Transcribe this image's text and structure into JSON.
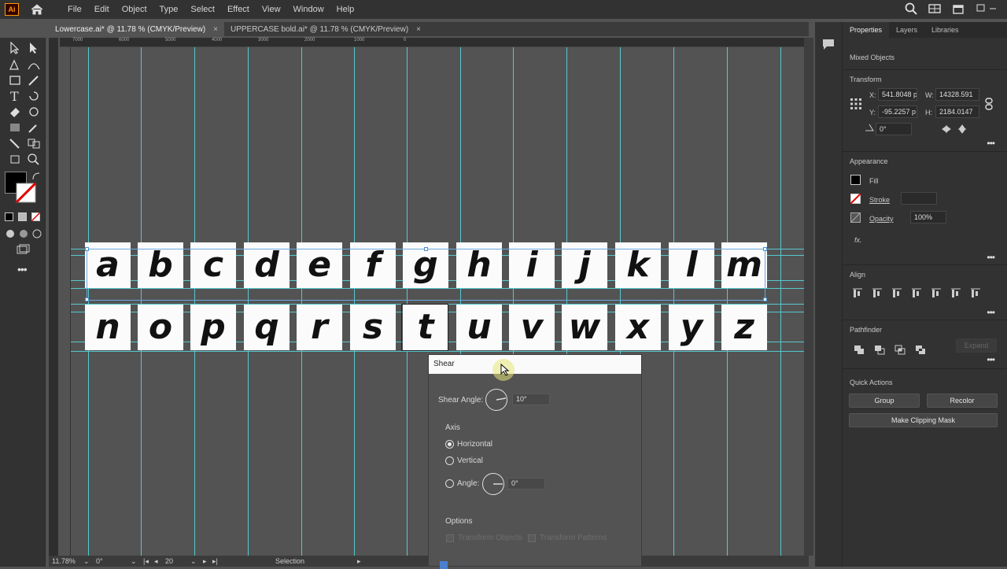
{
  "app": {
    "logo": "Ai"
  },
  "menu": [
    "File",
    "Edit",
    "Object",
    "Type",
    "Select",
    "Effect",
    "View",
    "Window",
    "Help"
  ],
  "tabs": [
    {
      "label": "Lowercase.ai* @ 11.78 % (CMYK/Preview)",
      "close": "×"
    },
    {
      "label": "UPPERCASE bold.ai* @ 11.78 % (CMYK/Preview)",
      "close": "×"
    }
  ],
  "ruler": [
    "7000",
    "6000",
    "5000",
    "4000",
    "3000",
    "2000",
    "1000",
    "0"
  ],
  "letters_row1": [
    "a",
    "b",
    "c",
    "d",
    "e",
    "f",
    "g",
    "h",
    "i",
    "j",
    "k",
    "l",
    "m"
  ],
  "letters_row2": [
    "n",
    "o",
    "p",
    "q",
    "r",
    "s",
    "t",
    "u",
    "v",
    "w",
    "x",
    "y",
    "z"
  ],
  "status": {
    "zoom": "11.78%",
    "rotate": "0°",
    "artboard": "20",
    "tool": "Selection"
  },
  "panel": {
    "tabs": [
      "Properties",
      "Layers",
      "Libraries"
    ],
    "selection": "Mixed Objects",
    "transform": {
      "title": "Transform",
      "x_label": "X:",
      "x": "541.8048 p",
      "y_label": "Y:",
      "y": "-95.2257 p",
      "w_label": "W:",
      "w": "14328.591",
      "h_label": "H:",
      "h": "2184.0147",
      "angle": "0°"
    },
    "appearance": {
      "title": "Appearance",
      "fill": "Fill",
      "stroke": "Stroke",
      "opacity": "Opacity",
      "opacity_value": "100%",
      "fx": "fx."
    },
    "align": {
      "title": "Align"
    },
    "pathfinder": {
      "title": "Pathfinder",
      "expand": "Expand"
    },
    "quick_actions": {
      "title": "Quick Actions",
      "group": "Group",
      "recolor": "Recolor",
      "clipping": "Make Clipping Mask"
    }
  },
  "dialog": {
    "title": "Shear",
    "shear_angle_label": "Shear Angle:",
    "shear_angle": "10°",
    "axis_title": "Axis",
    "horizontal": "Horizontal",
    "vertical": "Vertical",
    "angle_label": "Angle:",
    "angle_value": "0°",
    "options_title": "Options",
    "transform_objects": "Transform Objects",
    "transform_patterns": "Transform Patterns"
  }
}
